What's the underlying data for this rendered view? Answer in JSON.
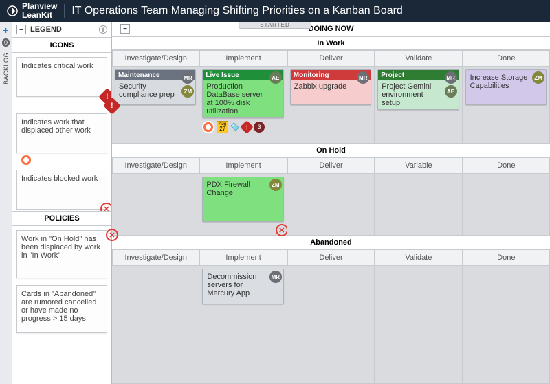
{
  "brand": {
    "line1": "Planview",
    "line2": "LeanKit"
  },
  "board_title": "IT Operations Team Managing Shifting Priorities on a Kanban Board",
  "started_label": "STARTED",
  "left_rail": {
    "backlog_label": "BACKLOG",
    "backlog_count": "0"
  },
  "legend": {
    "title": "LEGEND",
    "icons_title": "ICONS",
    "policies_title": "POLICIES",
    "icons": [
      {
        "text": "Indicates critical work"
      },
      {
        "text": "Indicates work that displaced other work"
      },
      {
        "text": "Indicates blocked work"
      }
    ],
    "policies": [
      {
        "text": "Work in \"On Hold\" has been displaced by work in \"In Work\""
      },
      {
        "text": "Cards in \"Abandoned\" are rumored cancelled or have made no progress > 15 days"
      }
    ]
  },
  "board": {
    "main_title": "DOING NOW",
    "lanes": [
      {
        "name": "In Work",
        "stages": [
          "Investigate/Design",
          "Implement",
          "Deliver",
          "Validate",
          "Done"
        ]
      },
      {
        "name": "On Hold",
        "stages": [
          "Investigate/Design",
          "Implement",
          "Deliver",
          "Variable",
          "Done"
        ]
      },
      {
        "name": "Abandoned",
        "stages": [
          "Investigate/Design",
          "Implement",
          "Deliver",
          "Validate",
          "Done"
        ]
      }
    ],
    "cards": {
      "inwork": [
        {
          "type": "Maintenance",
          "body": "Security compliance prep",
          "avatars": [
            "MR",
            "ZM"
          ]
        },
        {
          "type": "Live Issue",
          "body": "Production DataBase server at 100% disk utilization",
          "avatars": [
            "AE"
          ],
          "date": "Aug 27",
          "counter": "3"
        },
        {
          "type": "Monitoring",
          "body": "Zabbix upgrade",
          "avatars": [
            "MR"
          ]
        },
        {
          "type": "Project",
          "body": "Project Gemini environment setup",
          "avatars": [
            "MR",
            "AE"
          ]
        },
        {
          "body": "Increase Storage Capabilities",
          "avatars": [
            "ZM"
          ]
        }
      ],
      "onhold": [
        {
          "body": "PDX Firewall Change",
          "avatars": [
            "ZM"
          ]
        }
      ],
      "abandoned": [
        {
          "body": "Decommission servers for Mercury App",
          "avatars": [
            "MR"
          ]
        }
      ]
    }
  }
}
